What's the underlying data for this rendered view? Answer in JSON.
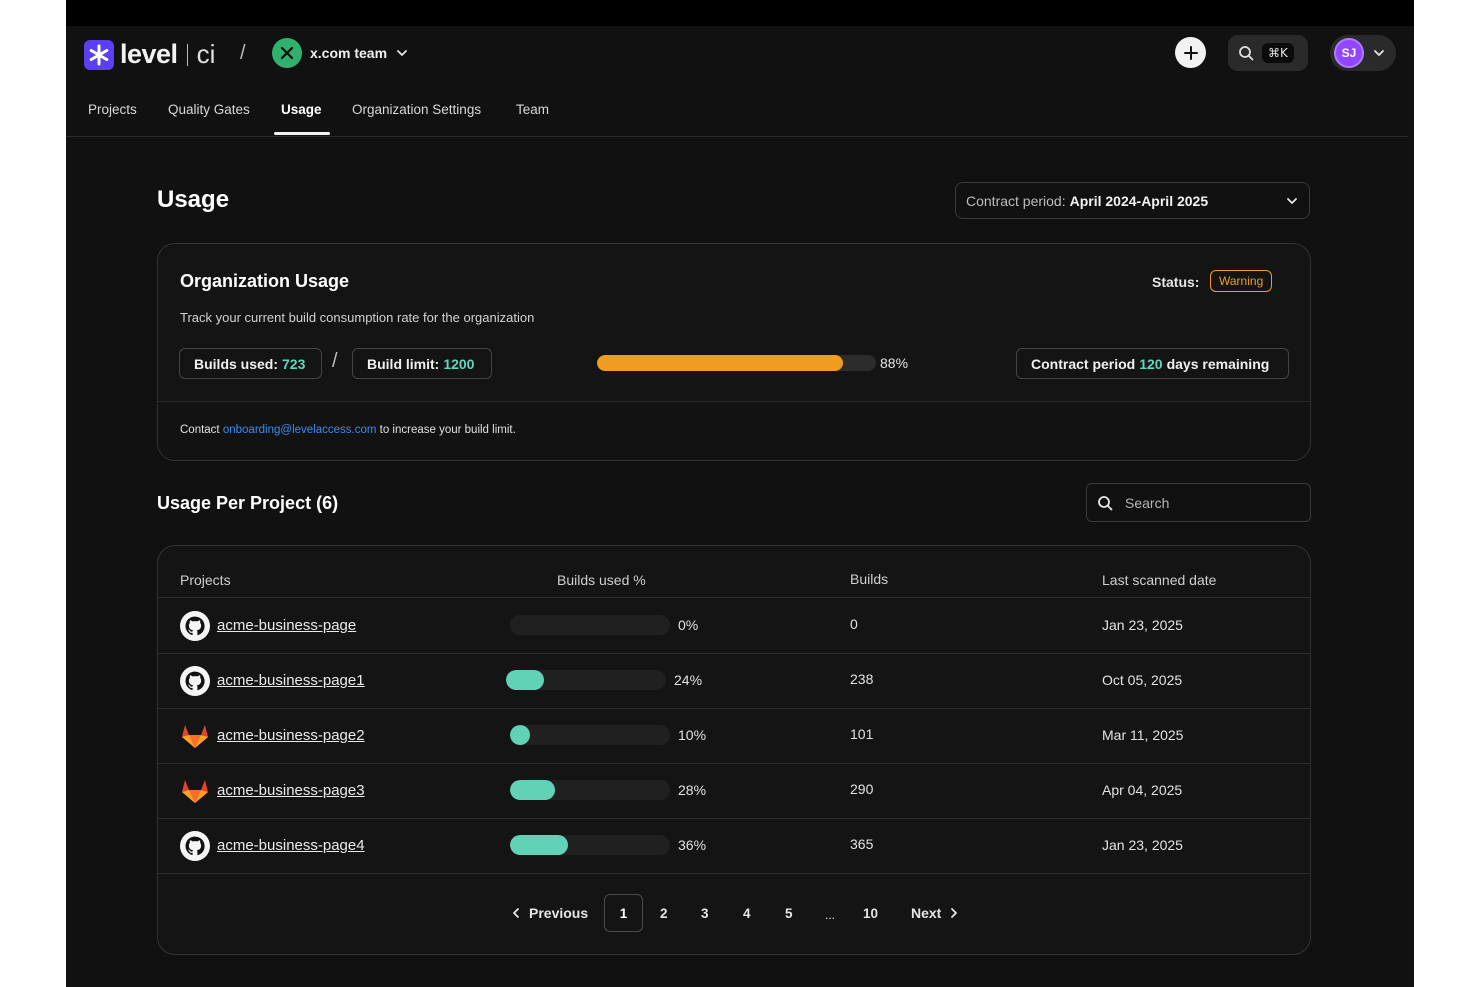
{
  "brand": {
    "name": "level",
    "suffix": "ci"
  },
  "team": {
    "name": "x.com team"
  },
  "header": {
    "shortcut": "⌘K",
    "user_initials": "SJ"
  },
  "nav": {
    "tabs": [
      {
        "label": "Projects"
      },
      {
        "label": "Quality Gates"
      },
      {
        "label": "Usage",
        "active": true
      },
      {
        "label": "Organization Settings"
      },
      {
        "label": "Team"
      }
    ]
  },
  "page": {
    "title": "Usage",
    "contract_period_label": "Contract period:",
    "contract_period_value": "April 2024-April 2025"
  },
  "org_usage": {
    "title": "Organization Usage",
    "subtitle": "Track your current build consumption rate for the organization",
    "status_label": "Status:",
    "status": "Warning",
    "builds_used_label": "Builds used:",
    "builds_used": "723",
    "build_limit_label": "Build limit:",
    "build_limit": "1200",
    "progress_percent": 88,
    "progress_text": "88%",
    "days_prefix": "Contract period",
    "days_value": "120",
    "days_suffix": "days remaining",
    "contact_prefix": "Contact",
    "contact_email": "onboarding@levelaccess.com",
    "contact_suffix": "to increase your build limit."
  },
  "projects_section": {
    "title": "Usage Per Project (6)",
    "search_placeholder": "Search"
  },
  "table": {
    "columns": [
      "Projects",
      "Builds used %",
      "Builds",
      "Last scanned date"
    ],
    "rows": [
      {
        "name": "acme-business-page",
        "provider": "github",
        "percent": 0,
        "percent_text": "0%",
        "builds": "0",
        "last_scanned": "Jan 23, 2025"
      },
      {
        "name": "acme-business-page1",
        "provider": "github",
        "percent": 24,
        "percent_text": "24%",
        "builds": "238",
        "last_scanned": "Oct 05, 2025"
      },
      {
        "name": "acme-business-page2",
        "provider": "gitlab",
        "percent": 10,
        "percent_text": "10%",
        "builds": "101",
        "last_scanned": "Mar 11, 2025"
      },
      {
        "name": "acme-business-page3",
        "provider": "gitlab",
        "percent": 28,
        "percent_text": "28%",
        "builds": "290",
        "last_scanned": "Apr 04, 2025"
      },
      {
        "name": "acme-business-page4",
        "provider": "github",
        "percent": 36,
        "percent_text": "36%",
        "builds": "365",
        "last_scanned": "Jan 23, 2025"
      }
    ]
  },
  "pagination": {
    "previous": "Previous",
    "next": "Next",
    "current": "1",
    "pages": [
      "2",
      "3",
      "4",
      "5",
      "...",
      "10"
    ]
  },
  "colors": {
    "warning": "#f29b22",
    "accent_teal": "#62d2b6",
    "link_blue": "#3b8cf0",
    "brand_purple": "#5b3ff0"
  }
}
